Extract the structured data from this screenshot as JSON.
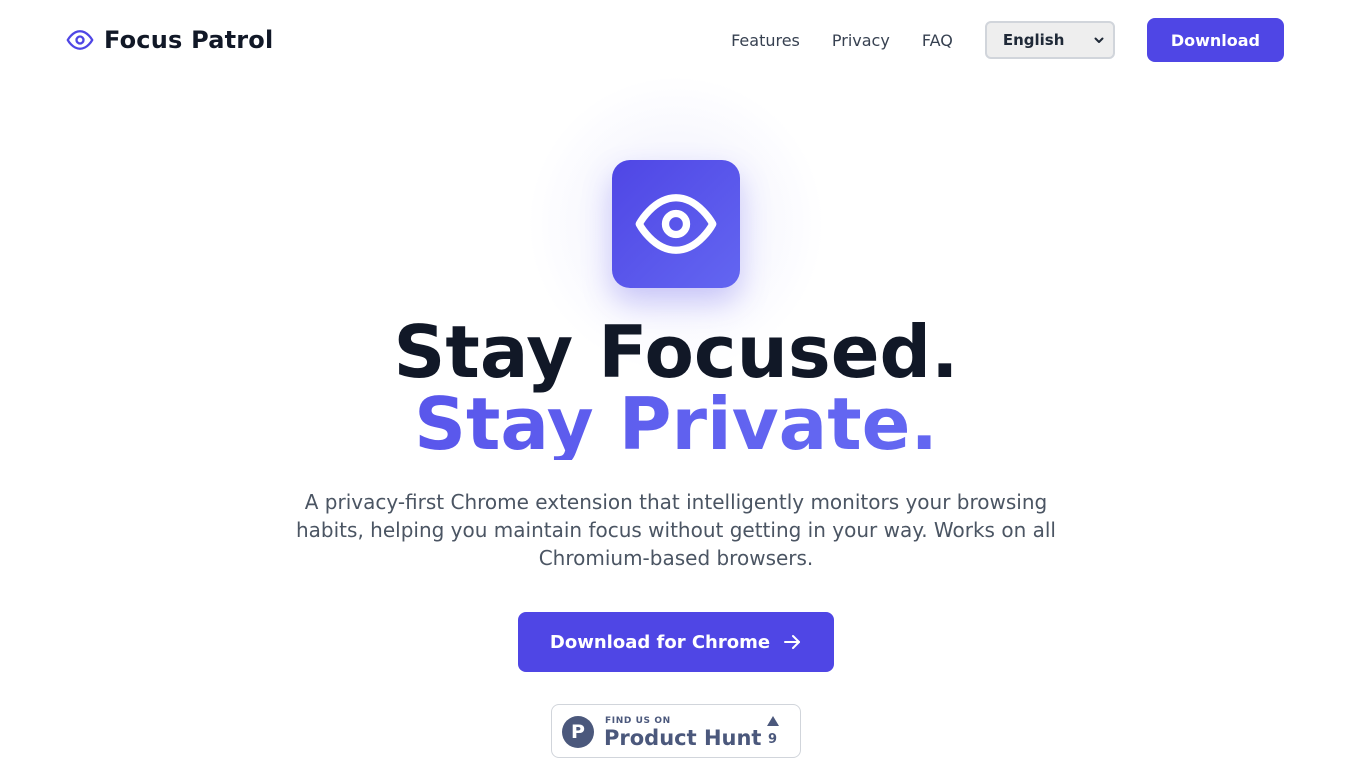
{
  "brand": {
    "name": "Focus Patrol",
    "icon": "eye-icon"
  },
  "nav": {
    "links": [
      "Features",
      "Privacy",
      "FAQ"
    ],
    "language": {
      "selected": "English"
    },
    "download_label": "Download"
  },
  "hero": {
    "logo_icon": "eye-icon",
    "headline_line1": "Stay Focused.",
    "headline_line2": "Stay Private.",
    "subtitle": "A privacy-first Chrome extension that intelligently monitors your browsing habits, helping you maintain focus without getting in your way. Works on all Chromium-based browsers.",
    "cta_label": "Download for Chrome",
    "cta_icon": "arrow-right-icon"
  },
  "product_hunt": {
    "small_text": "FIND US ON",
    "big_text": "Product Hunt",
    "logo_letter": "P",
    "upvote_icon": "triangle-up-icon",
    "upvotes": "9"
  },
  "colors": {
    "accent": "#4f46e5",
    "accent_light": "#6366f1",
    "text_dark": "#111827",
    "text_muted": "#4b5563",
    "product_hunt": "#4b587c"
  }
}
